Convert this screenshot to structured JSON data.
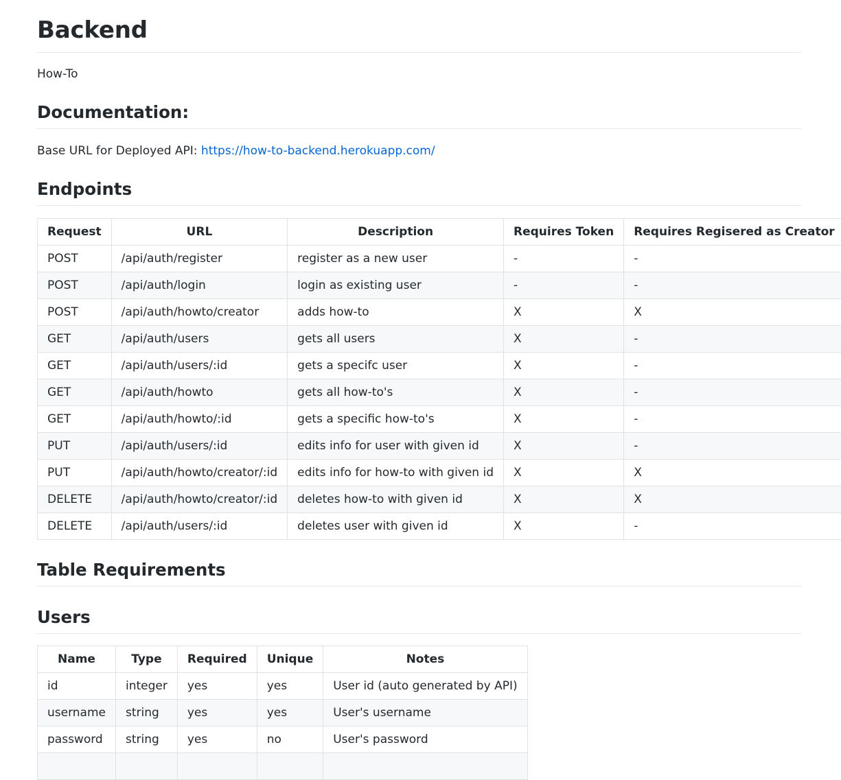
{
  "page": {
    "title": "Backend",
    "subtitle": "How-To",
    "documentation_heading": "Documentation:",
    "base_url_label": "Base URL for Deployed API: ",
    "base_url_link": "https://how-to-backend.herokuapp.com/",
    "endpoints_heading": "Endpoints",
    "table_requirements_heading": "Table Requirements",
    "users_heading": "Users"
  },
  "endpoints_table": {
    "headers": [
      "Request",
      "URL",
      "Description",
      "Requires Token",
      "Requires Regisered as Creator"
    ],
    "rows": [
      [
        "POST",
        "/api/auth/register",
        "register as a new user",
        "-",
        "-"
      ],
      [
        "POST",
        "/api/auth/login",
        "login as existing user",
        "-",
        "-"
      ],
      [
        "POST",
        "/api/auth/howto/creator",
        "adds how-to",
        "X",
        "X"
      ],
      [
        "GET",
        "/api/auth/users",
        "gets all users",
        "X",
        "-"
      ],
      [
        "GET",
        "/api/auth/users/:id",
        "gets a specifc user",
        "X",
        "-"
      ],
      [
        "GET",
        "/api/auth/howto",
        "gets all how-to's",
        "X",
        "-"
      ],
      [
        "GET",
        "/api/auth/howto/:id",
        "gets a specific how-to's",
        "X",
        "-"
      ],
      [
        "PUT",
        "/api/auth/users/:id",
        "edits info for user with given id",
        "X",
        "-"
      ],
      [
        "PUT",
        "/api/auth/howto/creator/:id",
        "edits info for how-to with given id",
        "X",
        "X"
      ],
      [
        "DELETE",
        "/api/auth/howto/creator/:id",
        "deletes how-to with given id",
        "X",
        "X"
      ],
      [
        "DELETE",
        "/api/auth/users/:id",
        "deletes user with given id",
        "X",
        "-"
      ]
    ]
  },
  "users_table": {
    "headers": [
      "Name",
      "Type",
      "Required",
      "Unique",
      "Notes"
    ],
    "rows": [
      [
        "id",
        "integer",
        "yes",
        "yes",
        "User id (auto generated by API)"
      ],
      [
        "username",
        "string",
        "yes",
        "yes",
        "User's username"
      ],
      [
        "password",
        "string",
        "yes",
        "no",
        "User's password"
      ],
      [
        "",
        "",
        "",
        "",
        ""
      ]
    ]
  },
  "colors": {
    "link": "#0366d6",
    "text": "#24292e",
    "table_border": "#dfe2e5",
    "row_stripe": "#f6f8fa"
  }
}
